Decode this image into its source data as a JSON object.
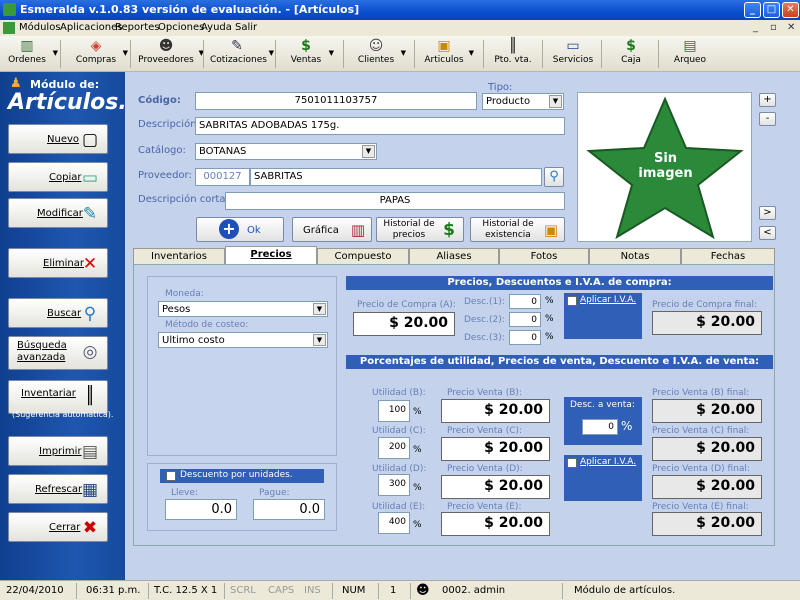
{
  "window": {
    "title": "Esmeralda v.1.0.83 versión de evaluación. - [Artículos]",
    "min": "_",
    "max": "□",
    "close": "✕"
  },
  "menu": [
    "Módulos",
    "Aplicaciones",
    "Reportes",
    "Opciones",
    "Ayuda",
    "Salir"
  ],
  "toolbar": [
    {
      "label": "Ordenes",
      "icon": "chart-icon",
      "glyph": "▥"
    },
    {
      "label": "Compras",
      "icon": "dice-icon",
      "glyph": "◈"
    },
    {
      "label": "Proveedores",
      "icon": "person-icon",
      "glyph": "☻"
    },
    {
      "label": "Cotizaciones",
      "icon": "document-icon",
      "glyph": "✎"
    },
    {
      "label": "Ventas",
      "icon": "dollar-icon",
      "glyph": "$"
    },
    {
      "label": "Clientes",
      "icon": "people-icon",
      "glyph": "☺"
    },
    {
      "label": "Articulos",
      "icon": "boxes-icon",
      "glyph": "▣"
    },
    {
      "label": "Pto. vta.",
      "icon": "barcode-icon",
      "glyph": "║"
    },
    {
      "label": "Servicios",
      "icon": "computer-icon",
      "glyph": "▭"
    },
    {
      "label": "Caja",
      "icon": "dollar-icon",
      "glyph": "$"
    },
    {
      "label": "Arqueo",
      "icon": "money-icon",
      "glyph": "▤"
    }
  ],
  "module": {
    "small": "Módulo de:",
    "big": "Artículos."
  },
  "sidebar": [
    {
      "label": "Nuevo",
      "glyph": "▢"
    },
    {
      "label": "Copiar",
      "glyph": "▭"
    },
    {
      "label": "Modificar",
      "glyph": "✎"
    },
    {
      "label": "Eliminar",
      "glyph": "✕"
    },
    {
      "label": "Buscar",
      "glyph": "⚲"
    },
    {
      "label": "Búsqueda avanzada",
      "glyph": "◎"
    },
    {
      "label": "Inventariar",
      "glyph": "║"
    },
    {
      "label": "Imprimir",
      "glyph": "▤"
    },
    {
      "label": "Refrescar",
      "glyph": "▦"
    },
    {
      "label": "Cerrar",
      "glyph": "✖"
    }
  ],
  "sugerencia": "(Sugerencia automatica).",
  "form": {
    "codigo_label": "Código:",
    "codigo": "7501011103757",
    "tipo_label": "Tipo:",
    "tipo": "Producto",
    "descripcion_label": "Descripción:",
    "descripcion": "SABRITAS ADOBADAS 175g.",
    "catalogo_label": "Catálogo:",
    "catalogo": "BOTANAS",
    "proveedor_label": "Proveedor:",
    "proveedor_id": "000127",
    "proveedor": "SABRITAS",
    "desc_corta_label": "Descripción corta:",
    "desc_corta": "PAPAS"
  },
  "image": {
    "text1": "Sin",
    "text2": "imagen"
  },
  "actions": {
    "ok": "Ok",
    "grafica": "Gráfica",
    "historial_precios": "Historial de precios",
    "historial_existencia": "Historial de existencia"
  },
  "tabs": [
    "Inventarios",
    "Precios",
    "Compuesto",
    "Aliases",
    "Fotos",
    "Notas",
    "Fechas"
  ],
  "precios": {
    "moneda_label": "Moneda:",
    "moneda": "Pesos",
    "metodo_label": "Método de costeo:",
    "metodo": "Ultimo costo",
    "descuento_unidades": "Descuento por unidades.",
    "lleve_label": "Lleve:",
    "lleve": "0.0",
    "pague_label": "Pague:",
    "pague": "0.0",
    "hdr_compra": "Precios, Descuentos e I.V.A. de compra:",
    "precio_compra_label": "Precio de Compra (A):",
    "precio_compra": "$ 20.00",
    "desc1_label": "Desc.(1):",
    "desc1": "0",
    "desc2_label": "Desc.(2):",
    "desc2": "0",
    "desc3_label": "Desc.(3):",
    "desc3": "0",
    "pct": "%",
    "aplicar_iva": "Aplicar I.V.A.",
    "precio_compra_final_label": "Precio de Compra final:",
    "precio_compra_final": "$ 20.00",
    "hdr_venta": "Porcentajes de utilidad, Precios de venta, Descuento e I.V.A. de venta:",
    "rows": [
      {
        "util_label": "Utilidad (B):",
        "util": "100",
        "pv_label": "Precio Venta (B):",
        "pv": "$ 20.00",
        "final_label": "Precio Venta (B) final:",
        "final": "$ 20.00"
      },
      {
        "util_label": "Utilidad (C):",
        "util": "200",
        "pv_label": "Precio Venta (C):",
        "pv": "$ 20.00",
        "final_label": "Precio Venta (C) final:",
        "final": "$ 20.00"
      },
      {
        "util_label": "Utilidad (D):",
        "util": "300",
        "pv_label": "Precio Venta (D):",
        "pv": "$ 20.00",
        "final_label": "Precio Venta (D) final:",
        "final": "$ 20.00"
      },
      {
        "util_label": "Utilidad (E):",
        "util": "400",
        "pv_label": "Precio Venta (E):",
        "pv": "$ 20.00",
        "final_label": "Precio Venta (E) final:",
        "final": "$ 20.00"
      }
    ],
    "desc_venta_label": "Desc. a venta:",
    "desc_venta": "0",
    "aplicar_iva_venta": "Aplicar I.V.A."
  },
  "status": {
    "date": "22/04/2010",
    "time": "06:31 p.m.",
    "tc": "T.C. 12.5 X 1",
    "scrl": "SCRL",
    "caps": "CAPS",
    "ins": "INS",
    "num": "NUM",
    "n": "1",
    "user": "0002. admin",
    "module": "Módulo de artículos."
  },
  "colors": {
    "accent": "#2f5fb7",
    "sidebar": "#1f57b0",
    "panel": "#c4d2ec",
    "star": "#2a8a3a"
  }
}
